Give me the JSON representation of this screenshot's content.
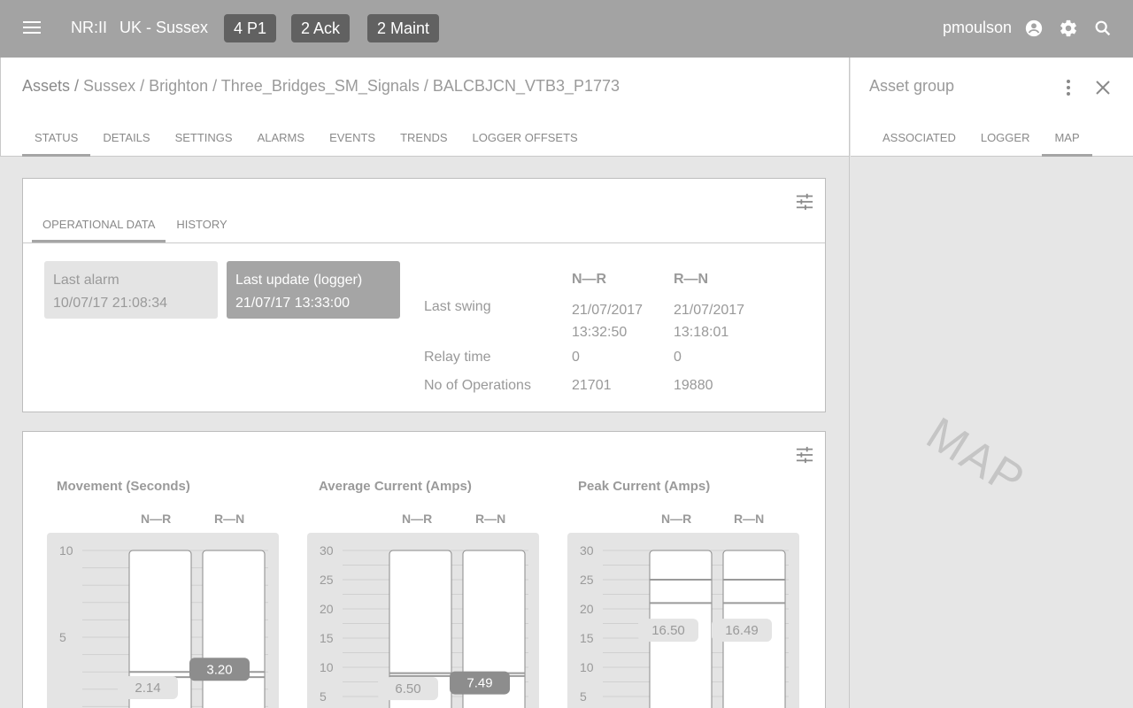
{
  "topbar": {
    "brand": "NR:II",
    "region": "UK - Sussex",
    "badges": [
      "4 P1",
      "2 Ack",
      "2 Maint"
    ],
    "user": "pmoulson",
    "colors": {
      "bar": "#a3a3a3",
      "badge": "#616161"
    }
  },
  "breadcrumb": {
    "root": "Assets /",
    "path": "Sussex / Brighton / Three_Bridges_SM_Signals / BALCBJCN_VTB3_P1773"
  },
  "tabs": [
    "STATUS",
    "DETAILS",
    "SETTINGS",
    "ALARMS",
    "EVENTS",
    "TRENDS",
    "LOGGER OFFSETS"
  ],
  "status": {
    "subtabs": [
      "OPERATIONAL DATA",
      "HISTORY"
    ],
    "last_alarm": {
      "label": "Last alarm",
      "value": "10/07/17  21:08:34"
    },
    "last_update": {
      "label": "Last update (logger)",
      "value": "21/07/17  13:33:00"
    },
    "ops": {
      "col_nr": "N—R",
      "col_rn": "R—N",
      "rows": [
        {
          "label": "Last swing",
          "nr": "21/07/2017",
          "nr2": "13:32:50",
          "rn": "21/07/2017",
          "rn2": "13:18:01"
        },
        {
          "label": "Relay time",
          "nr": "0",
          "rn": "0"
        },
        {
          "label": "No of Operations",
          "nr": "21701",
          "rn": "19880"
        }
      ]
    }
  },
  "chart_data": [
    {
      "type": "bar",
      "title": "Movement (Seconds)",
      "categories": [
        "N—R",
        "R—N"
      ],
      "values": [
        2.14,
        3.2
      ],
      "value_labels": [
        "2.14",
        "3.20"
      ],
      "highlight": [
        false,
        true
      ],
      "thresholds": [
        [
          3.0,
          2.7
        ],
        [
          3.0,
          2.7
        ]
      ],
      "ylim": [
        0,
        10
      ],
      "ticks": [
        "10",
        "5"
      ],
      "tick_values": [
        10,
        5
      ]
    },
    {
      "type": "bar",
      "title": "Average Current (Amps)",
      "categories": [
        "N—R",
        "R—N"
      ],
      "values": [
        6.5,
        7.49
      ],
      "value_labels": [
        "6.50",
        "7.49"
      ],
      "highlight": [
        false,
        true
      ],
      "thresholds": [
        [
          9.0,
          8.5
        ],
        [
          9.0,
          8.5
        ]
      ],
      "ylim": [
        0,
        30
      ],
      "ticks": [
        "30",
        "25",
        "20",
        "15",
        "10",
        "5"
      ],
      "tick_values": [
        30,
        25,
        20,
        15,
        10,
        5
      ]
    },
    {
      "type": "bar",
      "title": "Peak Current (Amps)",
      "categories": [
        "N—R",
        "R—N"
      ],
      "values": [
        16.5,
        16.49
      ],
      "value_labels": [
        "16.50",
        "16.49"
      ],
      "highlight": [
        false,
        false
      ],
      "thresholds": [
        [
          25,
          21
        ],
        [
          25,
          21
        ]
      ],
      "ylim": [
        0,
        30
      ],
      "ticks": [
        "30",
        "25",
        "20",
        "15",
        "10",
        "5"
      ],
      "tick_values": [
        30,
        25,
        20,
        15,
        10,
        5
      ]
    }
  ],
  "side": {
    "title": "Asset group",
    "tabs": [
      "ASSOCIATED",
      "LOGGER",
      "MAP"
    ],
    "map_label": "MAP"
  }
}
